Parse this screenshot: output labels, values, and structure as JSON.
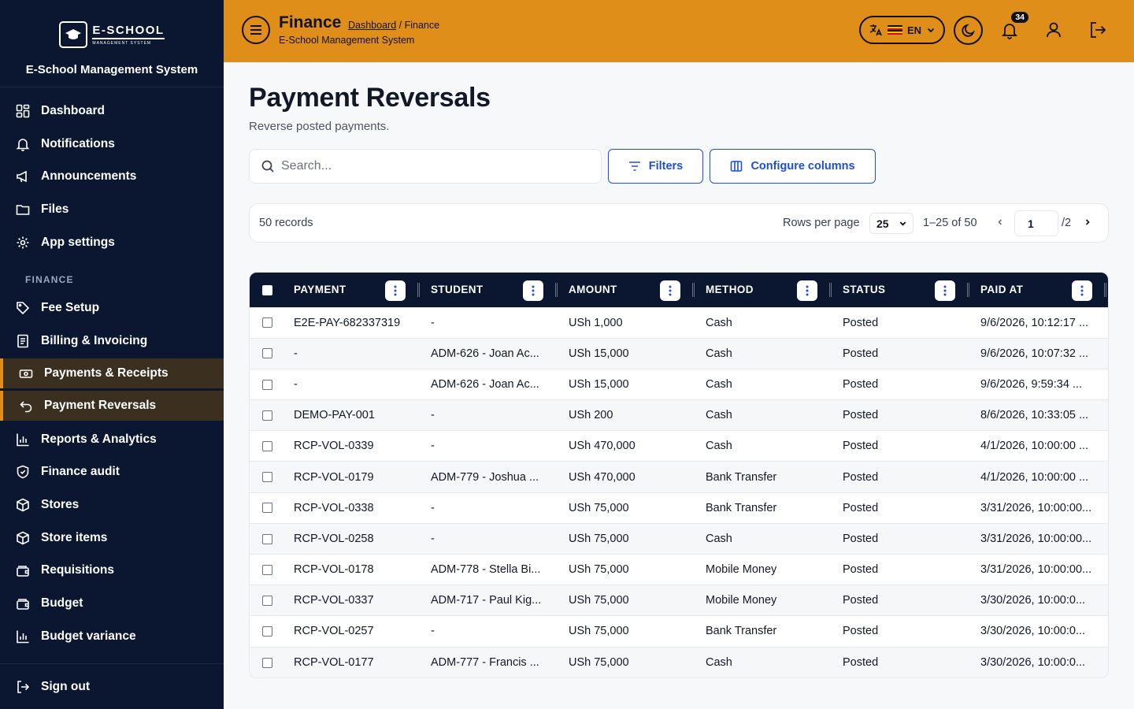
{
  "brand": {
    "logo_main": "E-SCHOOL",
    "logo_sub": "MANAGEMENT SYSTEM",
    "title": "E-School Management System"
  },
  "sidebar": {
    "items": [
      {
        "label": "Dashboard",
        "icon": "dashboard-icon"
      },
      {
        "label": "Notifications",
        "icon": "bell-icon"
      },
      {
        "label": "Announcements",
        "icon": "megaphone-icon"
      },
      {
        "label": "Files",
        "icon": "folder-icon"
      },
      {
        "label": "App settings",
        "icon": "gear-icon"
      }
    ],
    "section": "FINANCE",
    "finance_items": [
      {
        "label": "Fee Setup",
        "icon": "tag-icon"
      },
      {
        "label": "Billing & Invoicing",
        "icon": "invoice-icon"
      },
      {
        "label": "Payments & Receipts",
        "icon": "cash-icon"
      },
      {
        "label": "Payment Reversals",
        "icon": "undo-icon"
      },
      {
        "label": "Reports & Analytics",
        "icon": "bar-chart-icon"
      },
      {
        "label": "Finance audit",
        "icon": "shield-icon"
      },
      {
        "label": "Stores",
        "icon": "package-icon"
      },
      {
        "label": "Store items",
        "icon": "package-icon"
      },
      {
        "label": "Requisitions",
        "icon": "wallet-icon"
      },
      {
        "label": "Budget",
        "icon": "wallet-icon"
      },
      {
        "label": "Budget variance",
        "icon": "bar-chart-icon"
      }
    ],
    "signout": "Sign out"
  },
  "header": {
    "title": "Finance",
    "crumb_link": "Dashboard",
    "crumb_rest": " / Finance",
    "subtitle": "E-School Management System",
    "lang": "EN",
    "notif_count": "34",
    "accent": "#e08e1a"
  },
  "page": {
    "title": "Payment Reversals",
    "subtitle": "Reverse posted payments.",
    "search_placeholder": "Search...",
    "filters_label": "Filters",
    "columns_label": "Configure columns"
  },
  "pager": {
    "records": "50 records",
    "rows_label": "Rows per page",
    "rows_value": "25",
    "range": "1–25 of 50",
    "page": "1",
    "total": "/2"
  },
  "table": {
    "columns": [
      "PAYMENT",
      "STUDENT",
      "AMOUNT",
      "METHOD",
      "STATUS",
      "PAID AT"
    ],
    "rows": [
      [
        "E2E-PAY-682337319",
        "-",
        "USh 1,000",
        "Cash",
        "Posted",
        "9/6/2026, 10:12:17 ..."
      ],
      [
        "-",
        "ADM-626 - Joan Ac...",
        "USh 15,000",
        "Cash",
        "Posted",
        "9/6/2026, 10:07:32 ..."
      ],
      [
        "-",
        "ADM-626 - Joan Ac...",
        "USh 15,000",
        "Cash",
        "Posted",
        "9/6/2026, 9:59:34 ..."
      ],
      [
        "DEMO-PAY-001",
        "-",
        "USh 200",
        "Cash",
        "Posted",
        "8/6/2026, 10:33:05 ..."
      ],
      [
        "RCP-VOL-0339",
        "-",
        "USh 470,000",
        "Cash",
        "Posted",
        "4/1/2026, 10:00:00 ..."
      ],
      [
        "RCP-VOL-0179",
        "ADM-779 - Joshua ...",
        "USh 470,000",
        "Bank Transfer",
        "Posted",
        "4/1/2026, 10:00:00 ..."
      ],
      [
        "RCP-VOL-0338",
        "-",
        "USh 75,000",
        "Bank Transfer",
        "Posted",
        "3/31/2026, 10:00:00..."
      ],
      [
        "RCP-VOL-0258",
        "-",
        "USh 75,000",
        "Cash",
        "Posted",
        "3/31/2026, 10:00:00..."
      ],
      [
        "RCP-VOL-0178",
        "ADM-778 - Stella Bi...",
        "USh 75,000",
        "Mobile Money",
        "Posted",
        "3/31/2026, 10:00:00..."
      ],
      [
        "RCP-VOL-0337",
        "ADM-717 - Paul Kig...",
        "USh 75,000",
        "Mobile Money",
        "Posted",
        "3/30/2026, 10:00:0..."
      ],
      [
        "RCP-VOL-0257",
        "-",
        "USh 75,000",
        "Bank Transfer",
        "Posted",
        "3/30/2026, 10:00:0..."
      ],
      [
        "RCP-VOL-0177",
        "ADM-777 - Francis ...",
        "USh 75,000",
        "Cash",
        "Posted",
        "3/30/2026, 10:00:0..."
      ]
    ]
  }
}
